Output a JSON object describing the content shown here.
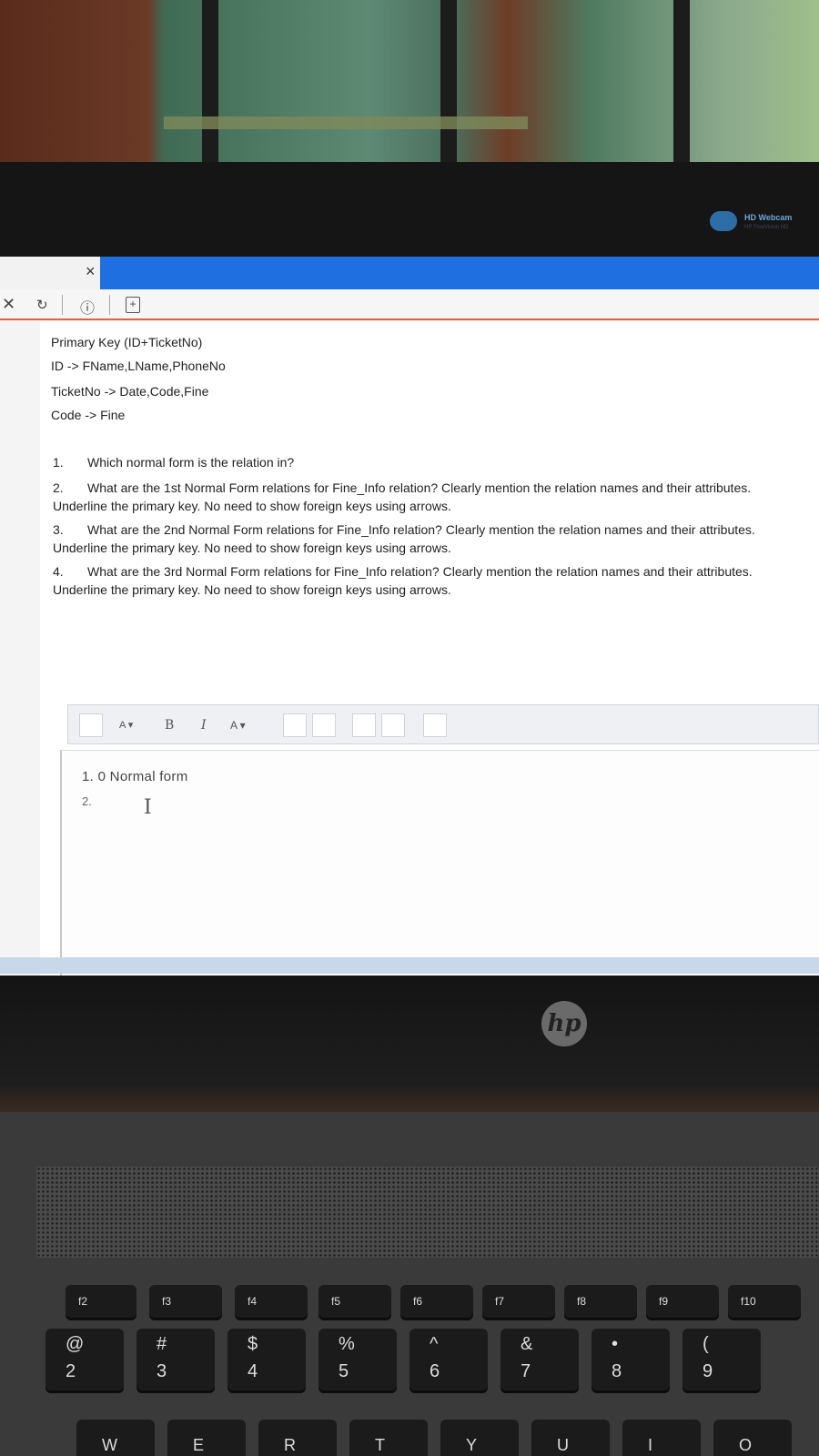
{
  "browser": {
    "tab_close": "×",
    "close_icon": "✕"
  },
  "webcam": {
    "label": "HD Webcam",
    "sub": "HP TrueVision HD"
  },
  "relation": {
    "lines": [
      "Primary Key (ID+TicketNo)",
      "ID -> FName,LName,PhoneNo",
      "TicketNo -> Date,Code,Fine",
      "Code -> Fine"
    ]
  },
  "questions": [
    {
      "num": "1.",
      "text": "Which normal form is the relation in?"
    },
    {
      "num": "2.",
      "text": "What are the 1st Normal Form relations for Fine_Info relation? Clearly mention the relation names and their attributes. Underline the primary key. No need to show foreign keys using arrows."
    },
    {
      "num": "3.",
      "text": "What are the 2nd Normal Form relations for Fine_Info relation? Clearly mention the relation names and their attributes. Underline the primary key. No need to show foreign keys using arrows."
    },
    {
      "num": "4.",
      "text": "What are the 3rd Normal Form relations for Fine_Info relation? Clearly mention the relation names and their attributes. Underline the primary key. No need to show foreign keys using arrows."
    }
  ],
  "editor": {
    "bold": "B",
    "italic": "I",
    "font_color": "A ▾",
    "font_size": "A ▾",
    "line1": "1. 0 Normal form",
    "line2": "2.",
    "caret": "I"
  },
  "brand": "hp",
  "keyboard": {
    "fkeys": [
      "f2",
      "f3",
      "f4",
      "f5",
      "f6",
      "f7",
      "f8",
      "f9",
      "f10"
    ],
    "number_keys": [
      {
        "top": "@",
        "bottom": "2"
      },
      {
        "top": "#",
        "bottom": "3"
      },
      {
        "top": "$",
        "bottom": "4"
      },
      {
        "top": "%",
        "bottom": "5"
      },
      {
        "top": "^",
        "bottom": "6"
      },
      {
        "top": "&",
        "bottom": "7"
      },
      {
        "top": "•",
        "bottom": "8"
      },
      {
        "top": "(",
        "bottom": "9"
      }
    ],
    "alpha_keys": [
      "W",
      "E",
      "R",
      "T",
      "Y",
      "U",
      "I",
      "O"
    ]
  }
}
